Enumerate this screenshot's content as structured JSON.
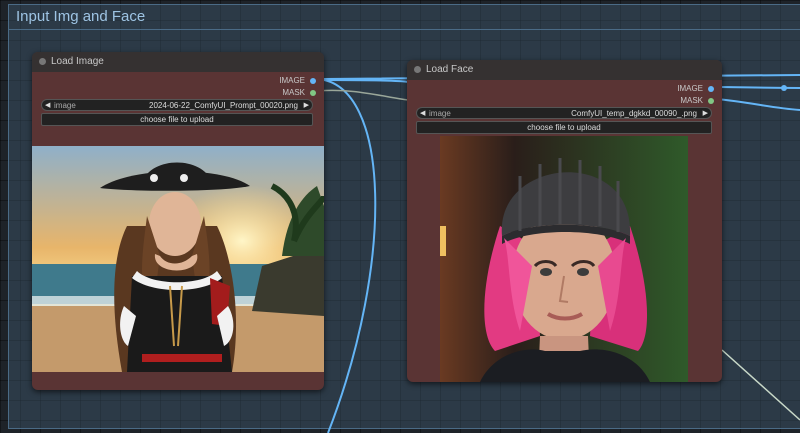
{
  "group": {
    "title": "Input Img and Face"
  },
  "nodes": {
    "load_image": {
      "title": "Load Image",
      "outputs": [
        "IMAGE",
        "MASK"
      ],
      "combo_label": "image",
      "combo_value": "2024-06-22_ComfyUI_Prompt_00020.png",
      "upload_label": "choose file to upload",
      "preview": "pirate-woman-beach-sunset"
    },
    "load_face": {
      "title": "Load Face",
      "outputs": [
        "IMAGE",
        "MASK"
      ],
      "combo_label": "image",
      "combo_value": "ComfyUI_temp_dgkkd_00090_.png",
      "upload_label": "choose file to upload",
      "preview": "woman-pink-hair-beanie"
    }
  },
  "colors": {
    "image_port": "#64b5f6",
    "mask_port": "#81c784",
    "wire_image": "#64b5f6",
    "wire_mask": "#8fb88f",
    "node_body": "#5a3434",
    "node_header": "#353131"
  }
}
